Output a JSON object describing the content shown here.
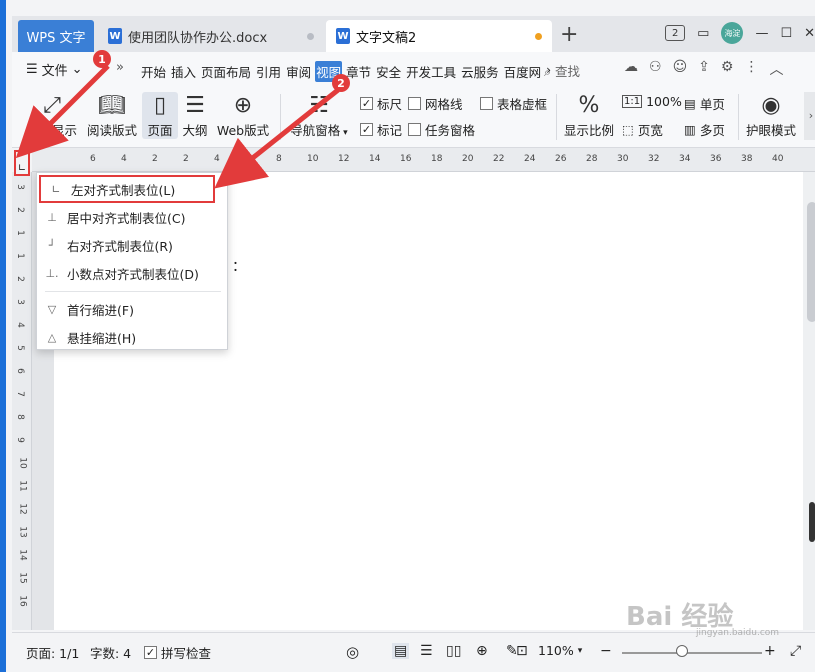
{
  "tabs": {
    "wps": "WPS 文字",
    "doc1": "使用团队协作办公.docx",
    "doc2": "文字文稿2",
    "doc_icon": "W"
  },
  "title_right": {
    "badge": "2",
    "avatar": "海淀"
  },
  "menubar": {
    "file": "文件",
    "tabs": [
      "开始",
      "插入",
      "页面布局",
      "引用",
      "审阅",
      "视图",
      "章节",
      "安全",
      "开发工具",
      "云服务",
      "百度网"
    ],
    "active_index": 5,
    "search": "查找"
  },
  "ribbon": {
    "full_display": "全屏显示",
    "read_mode": "阅读版式",
    "page": "页面",
    "outline": "大纲",
    "web": "Web版式",
    "nav_pane": "导航窗格",
    "ruler": "标尺",
    "gridlines": "网格线",
    "table_dashed": "表格虚框",
    "marks": "标记",
    "task_pane": "任务窗格",
    "show_ratio": "显示比例",
    "hundred": "100%",
    "page_width": "页宽",
    "single_page": "单页",
    "multi_page": "多页",
    "eye_mode": "护眼模式"
  },
  "ruler": {
    "top_labels": [
      "6",
      "4",
      "2",
      "2",
      "4",
      "6",
      "8",
      "10",
      "12",
      "14",
      "16",
      "18",
      "20",
      "22",
      "24",
      "26",
      "28",
      "30",
      "32",
      "34",
      "36",
      "38",
      "40"
    ],
    "left_labels": [
      "3",
      "2",
      "1",
      "1",
      "2",
      "3",
      "4",
      "5",
      "6",
      "7",
      "8",
      "9",
      "10",
      "11",
      "12",
      "13",
      "14",
      "15",
      "16"
    ]
  },
  "context_menu": {
    "items": [
      "左对齐式制表位(L)",
      "居中对齐式制表位(C)",
      "右对齐式制表位(R)",
      "小数点对齐式制表位(D)",
      "首行缩进(F)",
      "悬挂缩进(H)"
    ]
  },
  "page_text": "：",
  "status": {
    "page": "页面: 1/1",
    "words": "字数: 4",
    "spell": "拼写检查",
    "zoom": "110%"
  },
  "annotations": {
    "m1": "1",
    "m2": "2"
  },
  "watermark": {
    "main": "Bai 经验",
    "sub": "jingyan.baidu.com"
  },
  "colors": {
    "accent": "#3a7fd6",
    "annotation": "#e23b3b",
    "desktop": "#1c6fd8"
  }
}
